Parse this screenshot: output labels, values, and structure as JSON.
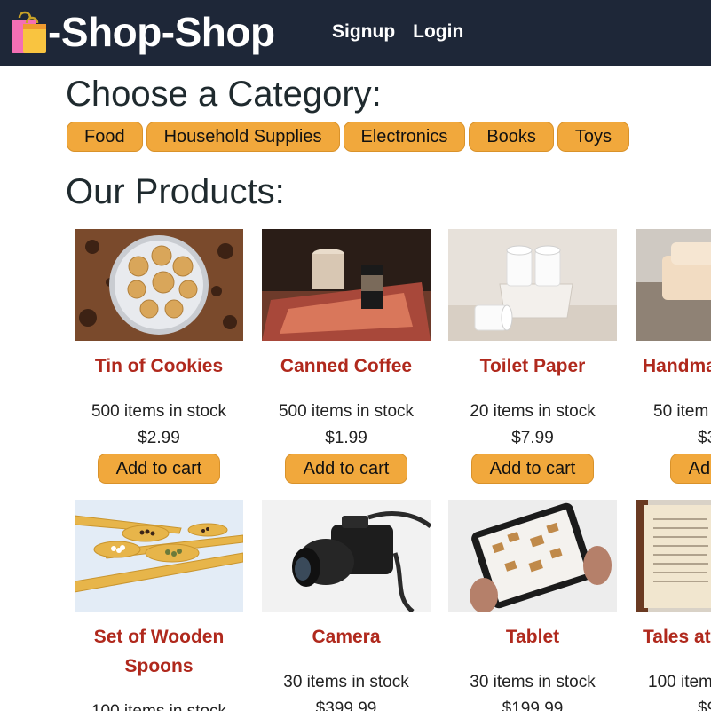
{
  "header": {
    "brand": "-Shop-Shop",
    "brand_icon": "shopping-bags-icon",
    "links": [
      "Signup",
      "Login"
    ]
  },
  "categories": {
    "title": "Choose a Category:",
    "items": [
      "Food",
      "Household Supplies",
      "Electronics",
      "Books",
      "Toys"
    ]
  },
  "products": {
    "title": "Our Products:",
    "add_label": "Add to cart",
    "items": [
      {
        "name": "Tin of Cookies",
        "stock": "500 items in stock",
        "price": "$2.99",
        "image": "cookies-image"
      },
      {
        "name": "Canned Coffee",
        "stock": "500 items in stock",
        "price": "$1.99",
        "image": "coffee-image"
      },
      {
        "name": "Toilet Paper",
        "stock": "20 items in stock",
        "price": "$7.99",
        "image": "toilet-paper-image"
      },
      {
        "name": "Handma",
        "stock": "50 item",
        "price": "$3",
        "image": "soap-image"
      },
      {
        "name": "Set of Wooden Spoons",
        "stock": "100 items in stock",
        "price": "",
        "image": "spoons-image"
      },
      {
        "name": "Camera",
        "stock": "30 items in stock",
        "price": "$399.99",
        "image": "camera-image"
      },
      {
        "name": "Tablet",
        "stock": "30 items in stock",
        "price": "$199.99",
        "image": "tablet-image"
      },
      {
        "name": "Tales at",
        "stock": "100 item",
        "price": "$9",
        "image": "book-image"
      }
    ]
  },
  "colors": {
    "nav_bg": "#1e2738",
    "accent": "#f1a83c",
    "product_name": "#b0291d"
  }
}
